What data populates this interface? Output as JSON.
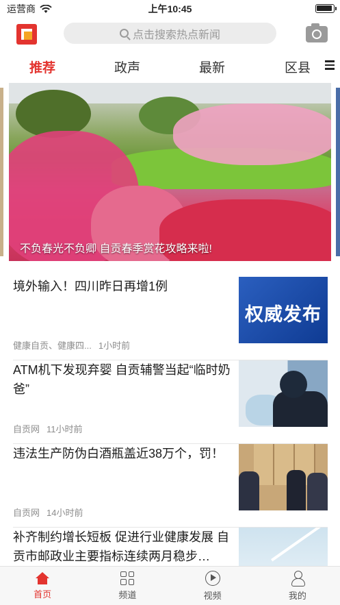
{
  "status_bar": {
    "carrier": "运营商",
    "time": "上午10:45"
  },
  "header": {
    "search_placeholder": "点击搜索热点新闻"
  },
  "tabs": [
    {
      "label": "推荐",
      "active": true
    },
    {
      "label": "政声",
      "active": false
    },
    {
      "label": "最新",
      "active": false
    },
    {
      "label": "区县",
      "active": false
    }
  ],
  "banner": {
    "caption": "不负春光不负卿 自贡春季赏花攻略来啦!"
  },
  "news": [
    {
      "title": "境外输入！四川昨日再增1例",
      "source": "健康自贡、健康四...",
      "time": "1小时前",
      "thumb_text": "权威发布"
    },
    {
      "title": "ATM机下发现弃婴  自贡辅警当起“临时奶爸”",
      "source": "自贡网",
      "time": "11小时前"
    },
    {
      "title": "违法生产防伪白酒瓶盖近38万个，罚！",
      "source": "自贡网",
      "time": "14小时前"
    },
    {
      "title": "补齐制约增长短板  促进行业健康发展 自贡市邮政业主要指标连续两月稳步…",
      "source": "",
      "time": ""
    }
  ],
  "bottom_nav": [
    {
      "label": "首页",
      "active": true
    },
    {
      "label": "频道",
      "active": false
    },
    {
      "label": "视频",
      "active": false
    },
    {
      "label": "我的",
      "active": false
    }
  ],
  "colors": {
    "accent": "#e3342f",
    "thumb_blue": "#2b5fbf"
  }
}
